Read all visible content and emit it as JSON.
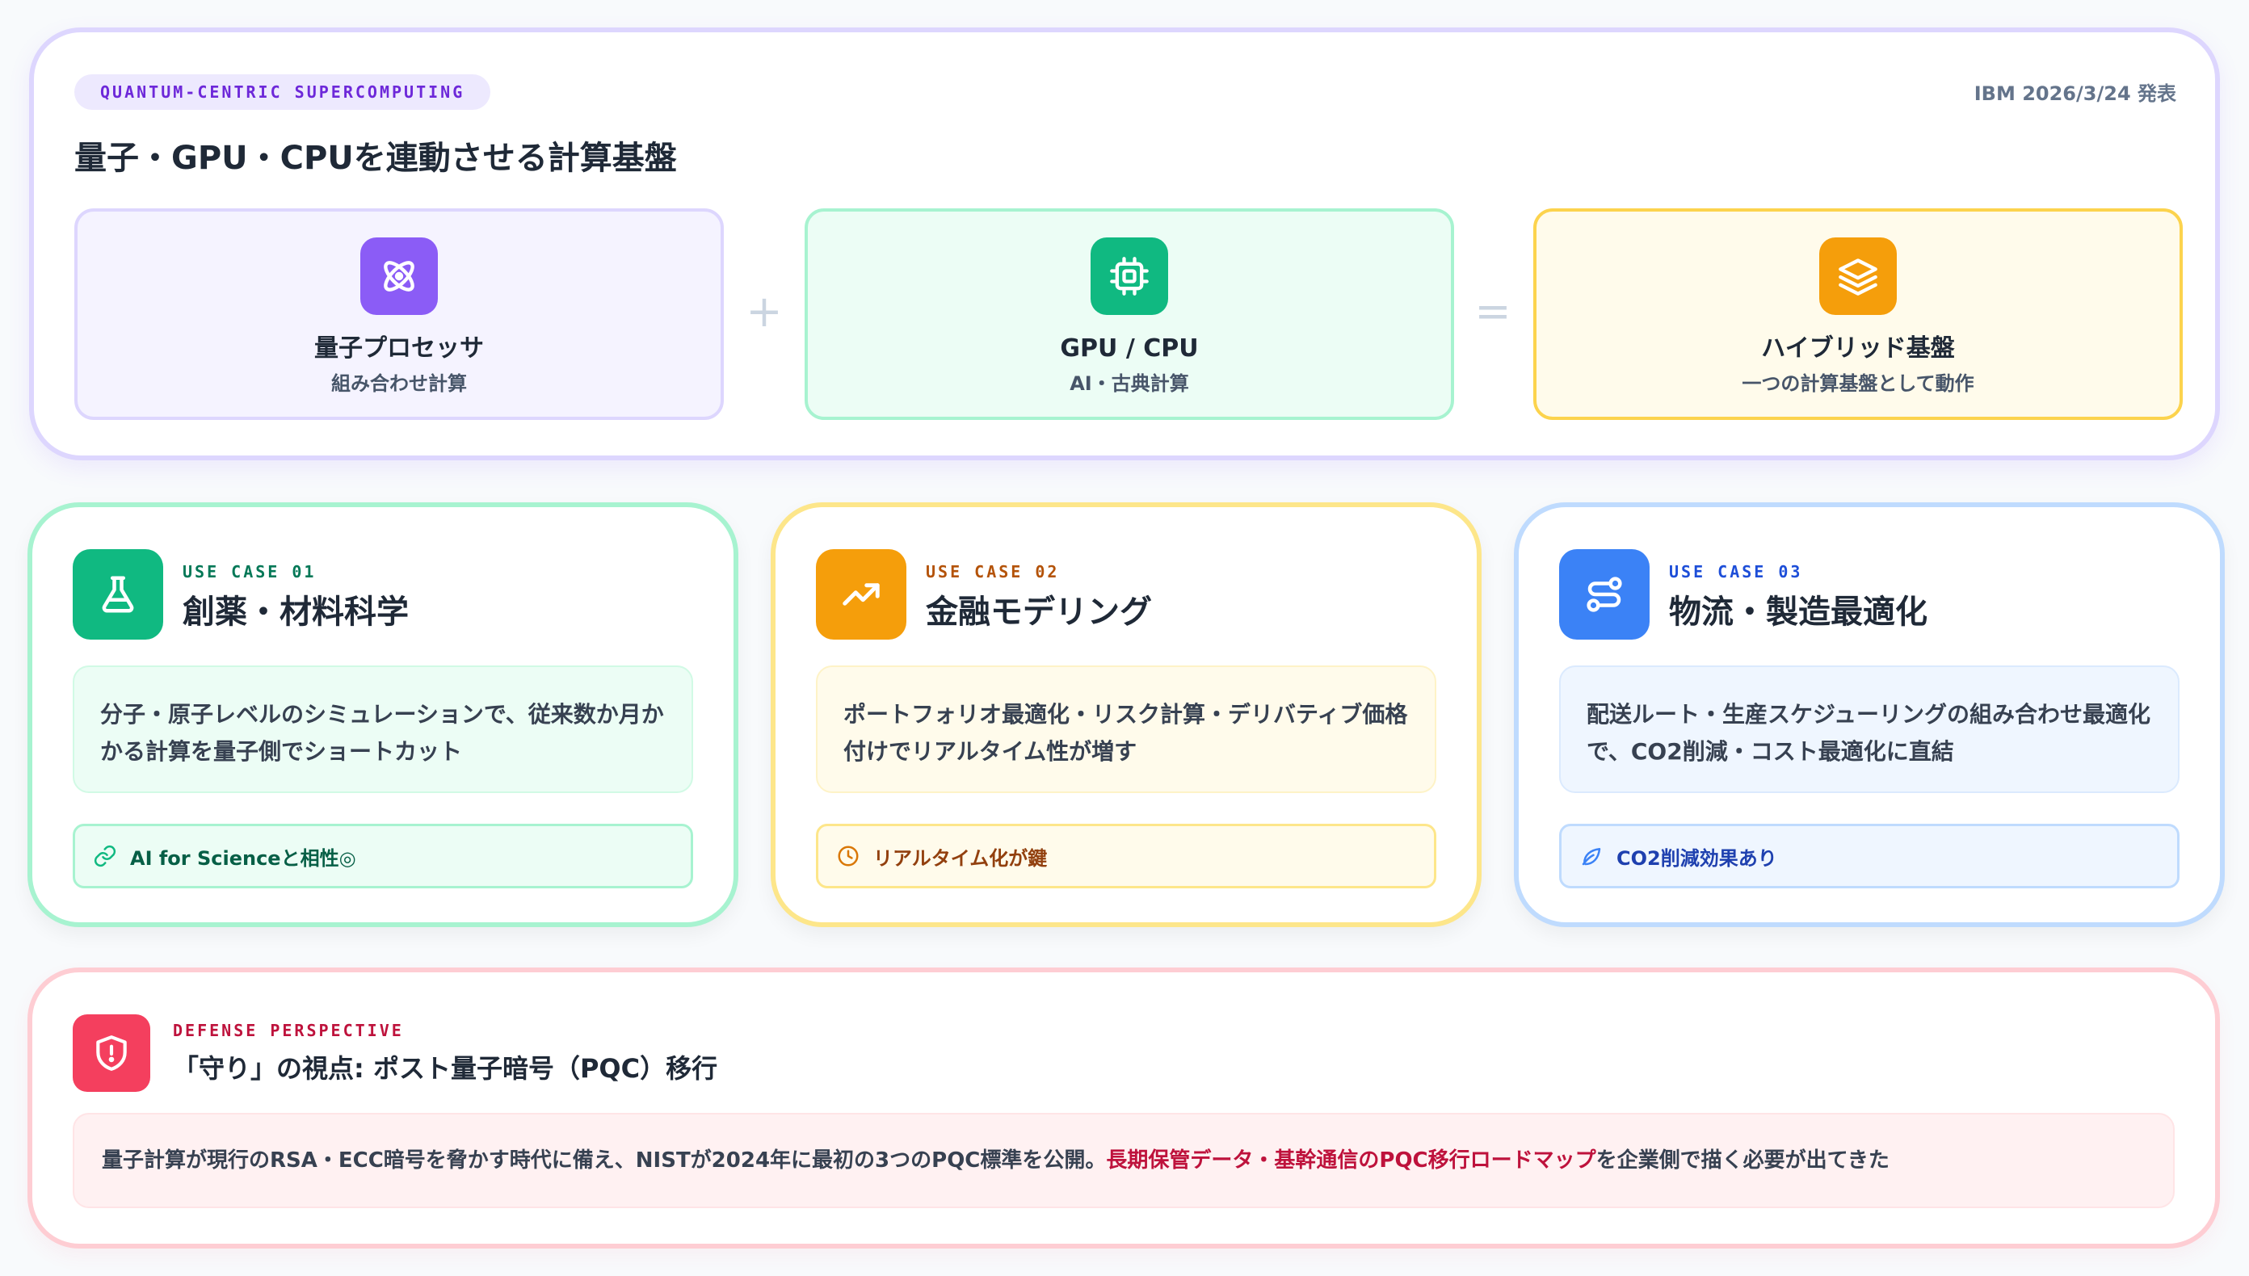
{
  "header": {
    "pill": "QUANTUM-CENTRIC SUPERCOMPUTING",
    "release": "IBM 2026/3/24 発表",
    "title": "量子・GPU・CPUを連動させる計算基盤"
  },
  "components": [
    {
      "title": "量子プロセッサ",
      "subtitle": "組み合わせ計算",
      "icon": "atom-icon",
      "color": "#8b5cf6"
    },
    {
      "title": "GPU / CPU",
      "subtitle": "AI・古典計算",
      "icon": "cpu-chip-icon",
      "color": "#10b981"
    },
    {
      "title": "ハイブリッド基盤",
      "subtitle": "一つの計算基盤として動作",
      "icon": "layers-icon",
      "color": "#f59e0b"
    }
  ],
  "operators": {
    "plus": "+",
    "equals": "="
  },
  "use_cases": [
    {
      "label": "USE CASE 01",
      "title": "創薬・材料科学",
      "description": "分子・原子レベルのシミュレーションで、従来数か月かかる計算を量子側でショートカット",
      "tag": "AI for Scienceと相性◎",
      "icon": "flask-icon",
      "tag_icon": "link-icon",
      "color": "#10b981"
    },
    {
      "label": "USE CASE 02",
      "title": "金融モデリング",
      "description": "ポートフォリオ最適化・リスク計算・デリバティブ価格付けでリアルタイム性が増す",
      "tag": "リアルタイム化が鍵",
      "icon": "trending-up-icon",
      "tag_icon": "clock-icon",
      "color": "#f59e0b"
    },
    {
      "label": "USE CASE 03",
      "title": "物流・製造最適化",
      "description": "配送ルート・生産スケジューリングの組み合わせ最適化で、CO2削減・コスト最適化に直結",
      "tag": "CO2削減効果あり",
      "icon": "route-icon",
      "tag_icon": "leaf-icon",
      "color": "#3b82f6"
    }
  ],
  "defense": {
    "label": "DEFENSE PERSPECTIVE",
    "title": "「守り」の視点: ポスト量子暗号（PQC）移行",
    "text_before": "量子計算が現行のRSA・ECC暗号を脅かす時代に備え、NISTが2024年に最初の3つのPQC標準を公開。",
    "text_highlight": "長期保管データ・基幹通信のPQC移行ロードマップ",
    "text_after": "を企業側で描く必要が出てきた",
    "icon": "shield-alert-icon",
    "color": "#f43f5e"
  }
}
